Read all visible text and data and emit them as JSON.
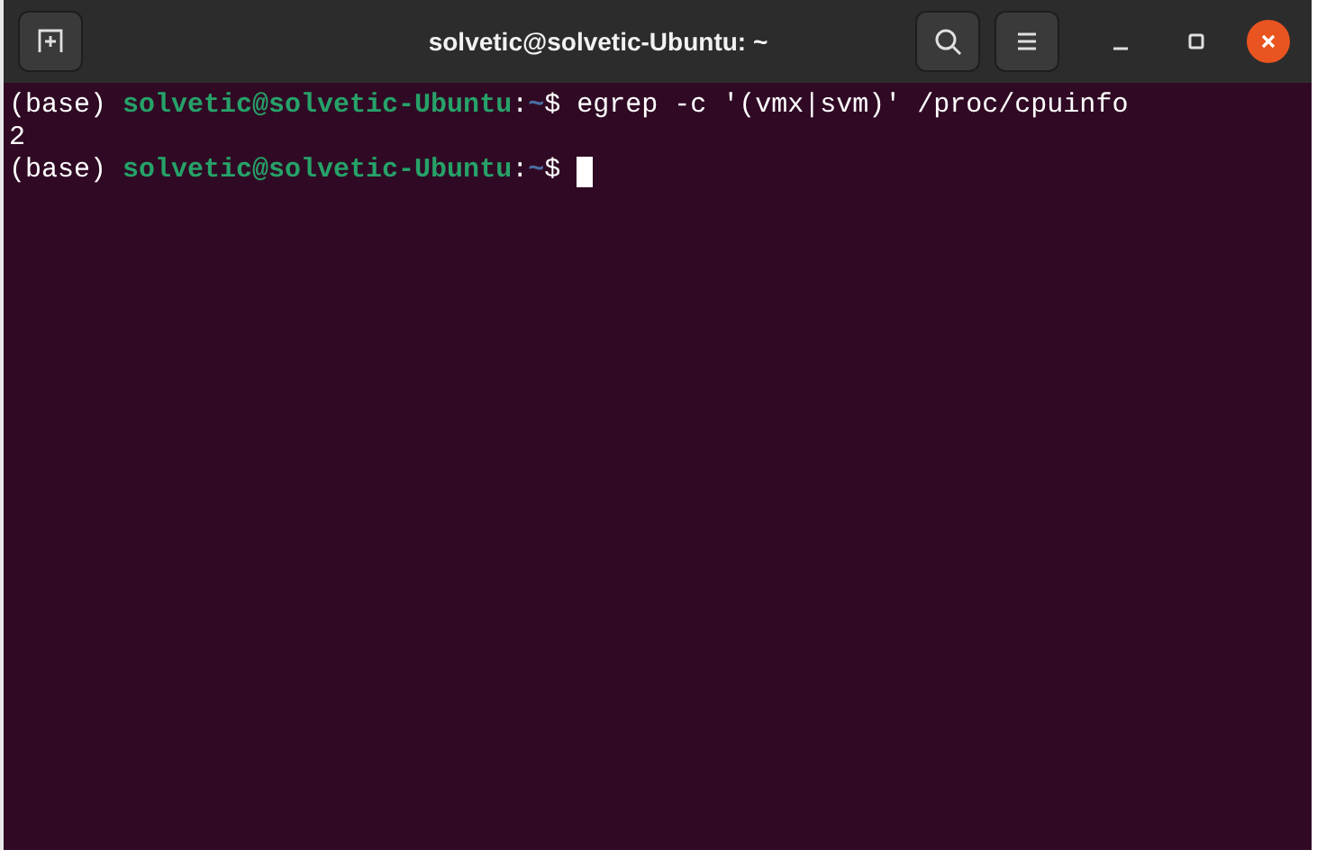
{
  "window": {
    "title": "solvetic@solvetic-Ubuntu: ~"
  },
  "terminal": {
    "lines": [
      {
        "kind": "prompt",
        "env": "(base)",
        "user_host": "solvetic@solvetic-Ubuntu",
        "separator": ":",
        "path": "~",
        "symbol": "$",
        "command": "egrep -c '(vmx|svm)' /proc/cpuinfo",
        "cursor": false
      },
      {
        "kind": "output",
        "text": "2"
      },
      {
        "kind": "prompt",
        "env": "(base)",
        "user_host": "solvetic@solvetic-Ubuntu",
        "separator": ":",
        "path": "~",
        "symbol": "$",
        "cursor": true
      }
    ]
  }
}
